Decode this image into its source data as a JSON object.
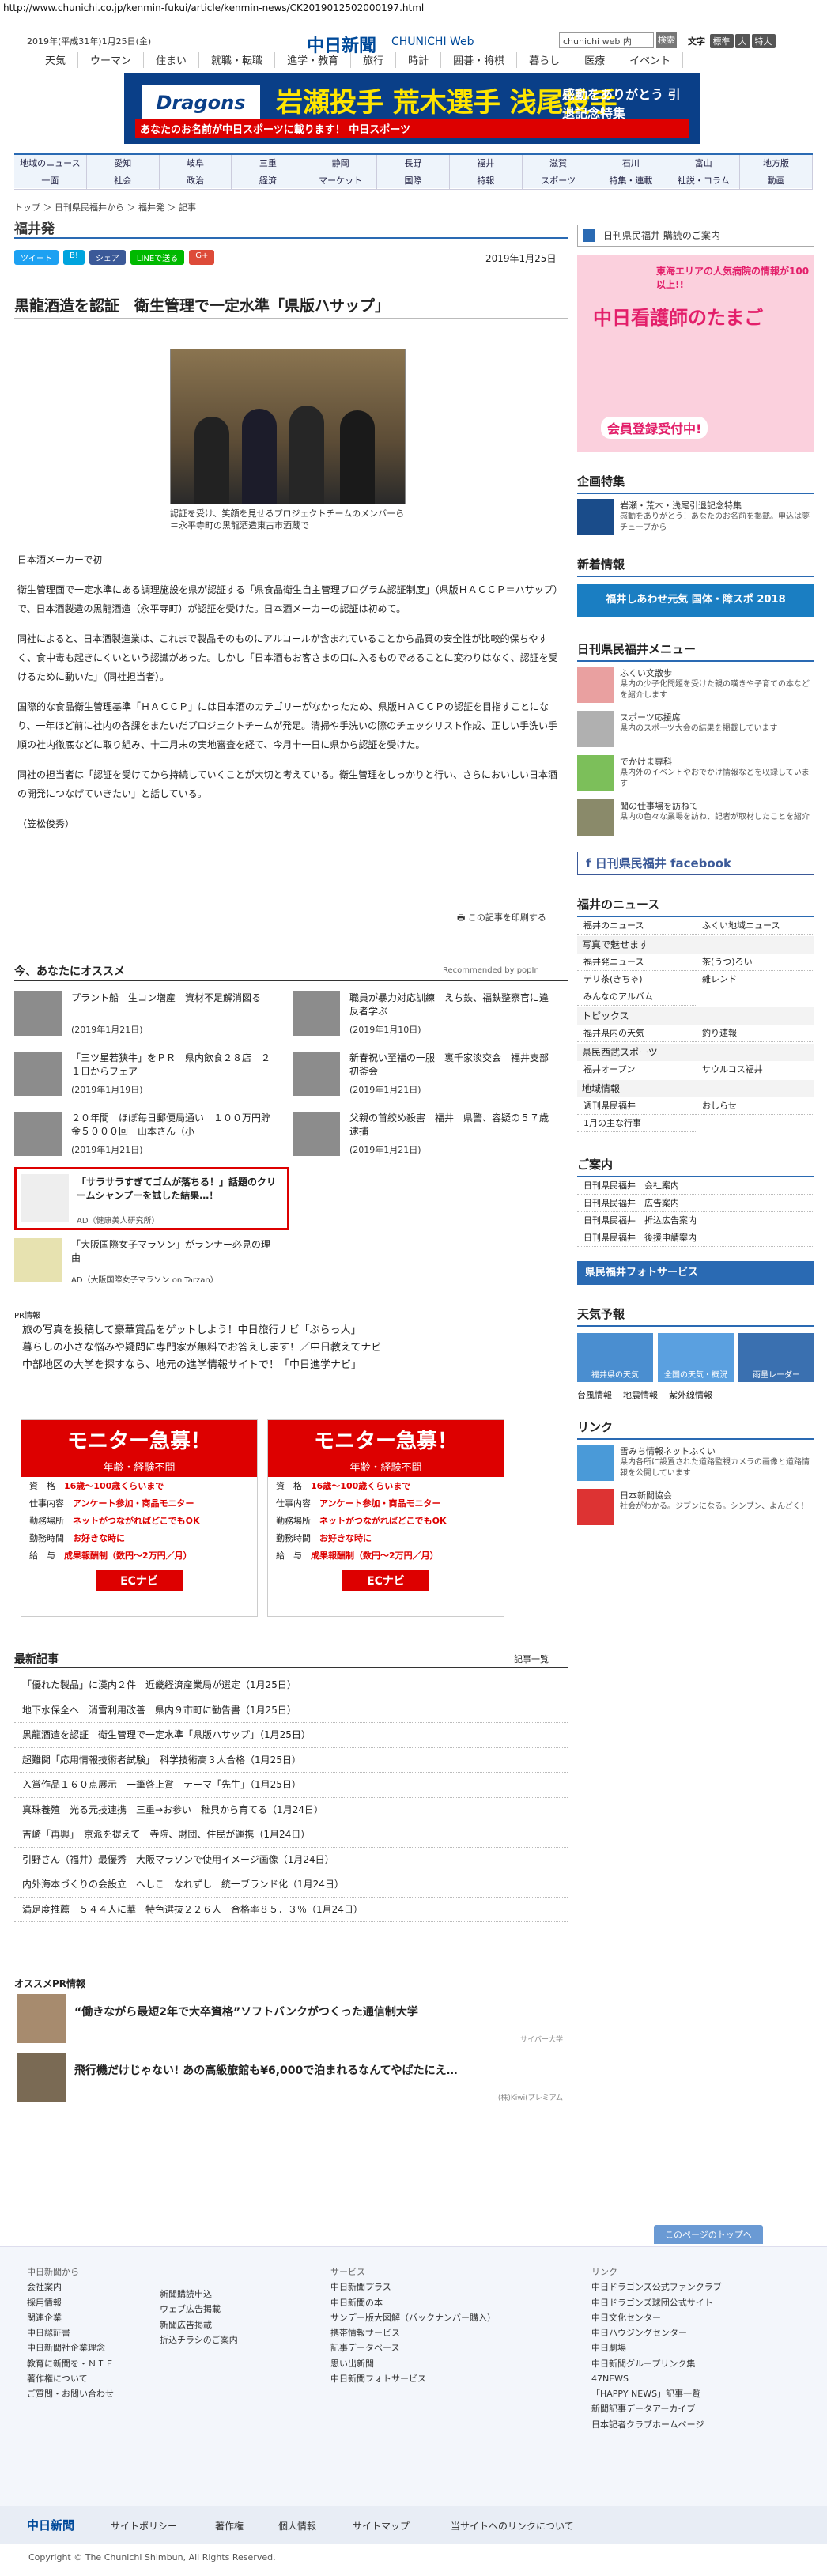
{
  "url": "http://www.chunichi.co.jp/kenmin-fukui/article/kenmin-news/CK2019012502000197.html",
  "header": {
    "date": "2019年(平成31年)1月25日(金)",
    "logo_jp": "中日新聞",
    "logo_en": "CHUNICHI Web",
    "search_placeholder": "chunichi web 内",
    "search_button": "検索",
    "font_label": "文字",
    "font_buttons": [
      "標準",
      "大",
      "特大"
    ]
  },
  "topnav": [
    "天気",
    "ウーマン",
    "住まい",
    "就職・転職",
    "進学・教育",
    "旅行",
    "時計",
    "囲碁・将棋",
    "暮らし",
    "医療",
    "イベント"
  ],
  "banner": {
    "logo": "Dragons",
    "title": "岩瀬投手 荒木選手 浅尾投手",
    "side": "感動をありがとう 引退記念特集",
    "sub": "あなたのお名前が中日スポーツに載ります！ 中日スポーツ"
  },
  "catnav": {
    "row1": [
      "地域のニュース",
      "愛知",
      "岐阜",
      "三重",
      "静岡",
      "長野",
      "福井",
      "滋賀",
      "石川",
      "富山",
      "地方版"
    ],
    "row2": [
      "一面",
      "社会",
      "政治",
      "経済",
      "マーケット",
      "国際",
      "特報",
      "スポーツ",
      "特集・連載",
      "社説・コラム",
      "動画"
    ]
  },
  "breadcrumb": "トップ ＞ 日刊県民福井から ＞ 福井発 ＞ 記事",
  "section_title": "福井発",
  "share": [
    "ツイート",
    "B!",
    "シェア",
    "LINEで送る",
    "G+"
  ],
  "article": {
    "date": "2019年1月25日",
    "headline": "黒龍酒造を認証　衛生管理で一定水準「県版ハサップ」",
    "caption": "認証を受け、笑顔を見せるプロジェクトチームのメンバーら＝永平寺町の黒龍酒造東古市酒蔵で",
    "lead": "日本酒メーカーで初",
    "paragraphs": [
      "衛生管理面で一定水準にある調理施設を県が認証する「県食品衛生自主管理プログラム認証制度」（県版ＨＡＣＣＰ＝ハサップ）で、日本酒製造の黒龍酒造（永平寺町）が認証を受けた。日本酒メーカーの認証は初めて。",
      "同社によると、日本酒製造業は、これまで製品そのものにアルコールが含まれていることから品質の安全性が比較的保ちやすく、食中毒も起きにくいという認識があった。しかし「日本酒もお客さまの口に入るものであることに変わりはなく、認証を受けるために動いた」（同社担当者）。",
      "国際的な食品衛生管理基準「ＨＡＣＣＰ」には日本酒のカテゴリーがなかったため、県版ＨＡＣＣＰの認証を目指すことになり、一年ほど前に社内の各課をまたいだプロジェクトチームが発足。清掃や手洗いの際のチェックリスト作成、正しい手洗い手順の社内徹底などに取り組み、十二月末の実地審査を経て、今月十一日に県から認証を受けた。",
      "同社の担当者は「認証を受けてから持続していくことが大切と考えている。衛生管理をしっかりと行い、さらにおいしい日本酒の開発につなげていきたい」と話している。",
      "（笠松俊秀）"
    ],
    "print": "この記事を印刷する"
  },
  "recommend": {
    "head": "今、あなたにオススメ",
    "by": "Recommended by popIn",
    "items": [
      {
        "text": "プラント船　生コン増産　資材不足解消図る",
        "date": "(2019年1月21日)"
      },
      {
        "text": "職員が暴力対応訓練　えち鉄、福鉄整察官に違反者学ぶ",
        "date": "(2019年1月10日)"
      },
      {
        "text": "「三ツ星若狭牛」をＰＲ　県内飲食２８店　２１日からフェア",
        "date": "(2019年1月19日)"
      },
      {
        "text": "新春祝い至福の一服　裏千家淡交会　福井支部初釜会",
        "date": "(2019年1月21日)"
      },
      {
        "text": "２０年間　ほぼ毎日郵便局通い　１００万円貯金５０００回　山本さん（小",
        "date": "(2019年1月21日)"
      },
      {
        "text": "父親の首絞め殺害　福井　県警、容疑の５７歳逮捕",
        "date": "(2019年1月21日)"
      }
    ],
    "ads": [
      {
        "text": "「サラサラすぎてゴムが落ちる！」話題のクリームシャンプーを試した結果…！",
        "src": "AD（健康美人研究所）"
      },
      {
        "text": "「大阪国際女子マラソン」がランナー必見の理由",
        "src": "AD（大阪国際女子マラソン on Tarzan）"
      }
    ]
  },
  "pr": {
    "label": "PR情報",
    "items": [
      "旅の写真を投稿して豪華賞品をゲットしよう！中日旅行ナビ「ぶらっ人」",
      "暮らしの小さな悩みや疑問に専門家が無料でお答えします！／中日教えてナビ",
      "中部地区の大学を探すなら、地元の進学情報サイトで！「中日進学ナビ」"
    ]
  },
  "monitor": {
    "title": "モニター急募！",
    "sub": "年齢・経験不問",
    "rows": [
      {
        "k": "資　格",
        "v": "16歳～100歳くらいまで"
      },
      {
        "k": "仕事内容",
        "v": "アンケート参加・商品モニター"
      },
      {
        "k": "勤務場所",
        "v": "ネットがつながればどこでもOK"
      },
      {
        "k": "勤務時間",
        "v": "お好きな時に"
      },
      {
        "k": "給　与",
        "v": "成果報酬制（数円～2万円／月）"
      }
    ],
    "logo": "ECナビ"
  },
  "latest": {
    "head": "最新記事",
    "more": "記事一覧",
    "items": [
      "「優れた製品」に漢内２件　近畿経済産業局が選定（1月25日）",
      "地下水保全へ　消雪利用改善　県内９市町に勧告書（1月25日）",
      "黒龍酒造を認証　衛生管理で一定水準「県版ハサップ」（1月25日）",
      "超難関「応用情報技術者試験」　科学技術高３人合格（1月25日）",
      "入賞作品１６０点展示　一筆啓上賞　テーマ「先生」（1月25日）",
      "真珠養殖　光る元技連携　三重→お参い　稚貝から育てる（1月24日）",
      "吉崎「再興」　京派を提えて　寺院、財団、住民が運携（1月24日）",
      "引野さん（福井）最優秀　大阪マラソンで使用イメージ画像（1月24日）",
      "内外海本づくりの会設立　へしこ　なれずし　統一ブランド化（1月24日）",
      "満足度推薦　５４４人に華　特色選抜２２６人　合格率８５．３％（1月24日）"
    ]
  },
  "osusume_pr": {
    "head": "オススメPR情報",
    "items": [
      {
        "text": "“働きながら最短2年で大卒資格”ソフトバンクがつくった通信制大学",
        "src": "サイバー大学"
      },
      {
        "text": "飛行機だけじゃない! あの高級旅館も¥6,000で泊まれるなんてやばたにえ…",
        "src": "(株)Kiwi(プレミアム"
      }
    ]
  },
  "sidebar": {
    "subscribe": "日刊県民福井 購読のご案内",
    "ad": {
      "t1": "中日看護師のたまご",
      "t2": "東海エリアの人気病院の情報が100以上!!",
      "t3": "会員登録受付中!"
    },
    "kikaku_head": "企画特集",
    "kikaku": [
      {
        "title": "岩瀬・荒木・浅尾引退記念特集",
        "desc": "感動をありがとう！あなたのお名前を掲載。申込は夢チューブから"
      }
    ],
    "chakushin_head": "新着情報",
    "chakushin_banner": "福井しあわせ元気 国体・障スポ 2018",
    "menu_head": "日刊県民福井メニュー",
    "menu": [
      {
        "title": "ふくい文散歩",
        "desc": "県内の少子化問題を受けた親の嘆きや子育ての本などを紹介します"
      },
      {
        "title": "スポーツ応援席",
        "desc": "県内のスポーツ大会の結果を掲載しています"
      },
      {
        "title": "でかけま専科",
        "desc": "県内外のイベントやおでかけ情報などを収録しています"
      },
      {
        "title": "聞の仕事場を訪ねて",
        "desc": "県内の色々な業場を訪ね、記者が取材したことを紹介"
      }
    ],
    "facebook": "日刊県民福井 facebook",
    "news_head": "福井のニュース",
    "news_top": [
      "福井のニュース",
      "ふくい地域ニュース"
    ],
    "news_sub1": "写真で魅せます",
    "news_grid1": [
      "福井発ニュース",
      "茶(うつ)ろい",
      "テリ茶(きちゃ)",
      "雑レンド",
      "みんなのアルバム"
    ],
    "news_sub2": "トピックス",
    "news_grid2": [
      "福井県内の天気",
      "釣り速報"
    ],
    "news_sub3": "県民西武スポーツ",
    "news_grid3": [
      "福井オープン",
      "サウルコス福井"
    ],
    "news_sub4": "地域情報",
    "news_grid4": [
      "週刊県民福井",
      "おしらせ",
      "1月の主な行事"
    ],
    "info_head": "ご案内",
    "info": [
      "日刊県民福井　会社案内",
      "日刊県民福井　広告案内",
      "日刊県民福井　折込広告案内",
      "日刊県民福井　後援申請案内"
    ],
    "photo_service": "県民福井フォトサービス",
    "weather_head": "天気予報",
    "weather": [
      "福井県の天気",
      "全国の天気・概況",
      "雨量レーダー"
    ],
    "weather_links": [
      "台風情報",
      "地震情報",
      "紫外線情報"
    ],
    "link_head": "リンク",
    "links": [
      {
        "title": "雪みち情報ネットふくい",
        "desc": "県内各所に設置された道路監視カメラの画像と道路情報を公開しています"
      },
      {
        "title": "日本新聞協会",
        "desc": "社会がわかる。ジブンになる。シンブン、よんどく！"
      }
    ]
  },
  "footer": {
    "pagetop": "このページのトップへ",
    "col1_head": "中日新聞から",
    "col1": [
      "会社案内",
      "採用情報",
      "関連企業",
      "中日認証書",
      "中日新聞社企業理念",
      "教育に新聞を・ＮＩＥ",
      "著作権について"
    ],
    "col1_last": "ご質問・お問い合わせ",
    "col2": [
      "新聞購読申込",
      "ウェブ広告掲載",
      "新聞広告掲載",
      "折込チラシのご案内"
    ],
    "col3_head": "サービス",
    "col3": [
      "中日新聞プラス",
      "中日新聞の本",
      "サンデー版大図解（バックナンバー購入）",
      "携帯情報サービス",
      "記事データベース",
      "思い出新聞",
      "中日新聞フォトサービス"
    ],
    "col4_head": "リンク",
    "col4": [
      "中日ドラゴンズ公式ファンクラブ",
      "中日ドラゴンズ球団公式サイト",
      "中日文化センター",
      "中日ハウジングセンター",
      "中日劇場",
      "中日新聞グループリンク集",
      "47NEWS",
      "「HAPPY NEWS」記事一覧",
      "新聞記事データアーカイブ",
      "日本記者クラブホームページ"
    ],
    "bar": [
      "中日新聞",
      "サイトポリシー",
      "著作権",
      "個人情報",
      "サイトマップ",
      "当サイトへのリンクについて"
    ],
    "copyright": "Copyright © The Chunichi Shimbun, All Rights Reserved."
  }
}
